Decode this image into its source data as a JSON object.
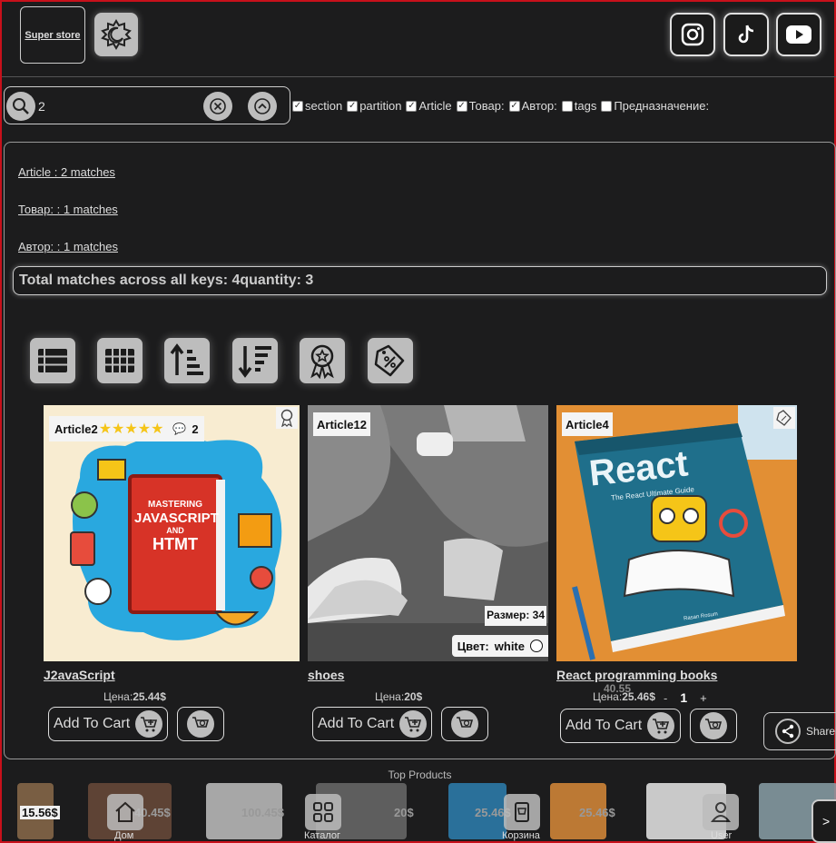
{
  "header": {
    "store_label": "Super store"
  },
  "search": {
    "value": "2",
    "filters": [
      {
        "label": "section",
        "checked": true
      },
      {
        "label": "partition",
        "checked": true
      },
      {
        "label": "Article",
        "checked": true
      },
      {
        "label": "Товар:",
        "checked": true
      },
      {
        "label": "Автор:",
        "checked": true
      },
      {
        "label": "tags",
        "checked": false
      },
      {
        "label": "Предназначение:",
        "checked": false
      }
    ]
  },
  "results": {
    "lines": [
      "Article : 2 matches",
      "Товар: : 1 matches",
      "Автор: : 1 matches"
    ],
    "total": "Total matches across all keys: 4quantity: 3"
  },
  "cards": [
    {
      "badge": "Article2",
      "rating": 5,
      "comments": "2",
      "title": "J2avaScript",
      "price_label": "Цена:",
      "price": "25.44$",
      "cover_text": [
        "MASTERING",
        "JAVASCRIPT",
        "AND",
        "HTMT"
      ]
    },
    {
      "badge": "Article12",
      "size_label": "Размер: 34",
      "color_label": "Цвет:",
      "color_value": "white",
      "title": "shoes",
      "price_label": "Цена:",
      "price": "20$"
    },
    {
      "badge": "Article4",
      "title": "React programming books",
      "price_label": "Цена:",
      "price": "25.46$",
      "old_price": "40.55",
      "qty_minus": "-",
      "qty": "1",
      "qty_plus": "+",
      "cover_title": "React",
      "cover_sub": "The React Ultimate Guide",
      "cover_author": "Rasan Rosum"
    }
  ],
  "actions": {
    "add_to_cart": "Add To Cart",
    "share": "Share"
  },
  "top_products": {
    "title": "Top Products",
    "prices": [
      "15.56$",
      "40.45$",
      "100.45$",
      "20$",
      "25.46$",
      "25.46$"
    ]
  },
  "bottom_nav": {
    "home": "Дом",
    "catalog": "Каталог",
    "cart": "Корзина",
    "user": "User",
    "next": ">"
  },
  "colors": {
    "bg": "#1c1c1d",
    "border": "#c8101b",
    "button_gray": "#bdbdbd",
    "star": "#f5c518"
  }
}
